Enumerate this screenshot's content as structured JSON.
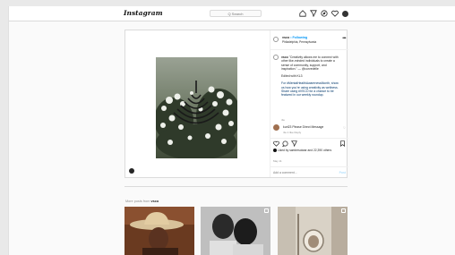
{
  "header": {
    "logo": "Instagram",
    "search_placeholder": "Q Search",
    "icons": [
      "home-icon",
      "direct-icon",
      "explore-icon",
      "activity-heart-icon",
      "profile-avatar"
    ]
  },
  "post": {
    "username": "vsco",
    "following": "• Following",
    "location": "Philadelphia, Pennsylvania",
    "more": "•••",
    "caption": {
      "username": "vsco",
      "line1": "\"Creativity allows me to connect with other like-minded individuals to create a sense of community, support, and inspiration.\" — @curvedelle",
      "line2": "Edited with KL3",
      "line3": "For #MentalHealthAwarenessMonth, show us how you're using creativity as wellness. Share using #VSCO for a chance to be featured in our weekly roundup.",
      "time": "4w"
    },
    "comment": {
      "text": "kurt23 Please Direct Message",
      "meta": "4w   1 like   Reply"
    },
    "likes": {
      "text": "Liked by samiresolwar and 22,390 others"
    },
    "date": "May 11",
    "add_comment_placeholder": "Add a comment...",
    "post_button": "Post"
  },
  "more_posts": {
    "label_prefix": "More posts from",
    "username": "vsco"
  },
  "colors": {
    "accent": "#0095f6",
    "border": "#dbdbdb",
    "background": "#fafafa"
  }
}
